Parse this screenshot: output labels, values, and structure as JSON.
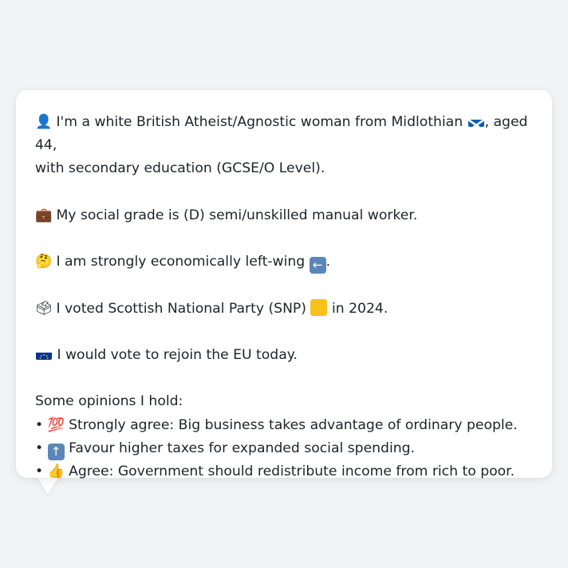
{
  "persona": {
    "line1_icon": "bust-in-silhouette-icon",
    "line1_text_a": "I'm a white British Atheist/Agnostic woman from Midlothian",
    "line1_flag": "scotland-flag-icon",
    "line1_text_b": ", aged 44,",
    "line1_text_c": "with secondary education (GCSE/O Level).",
    "line2_icon": "briefcase-icon",
    "line2_text": "My social grade is (D) semi/unskilled manual worker.",
    "line3_icon": "thinking-face-icon",
    "line3_text": "I am strongly economically left-wing",
    "line3_badge": "left-arrow-icon",
    "line3_end": ".",
    "line4_icon": "ballot-box-icon",
    "line4_text_a": "I voted Scottish National Party (SNP)",
    "line4_badge": "yellow-square-icon",
    "line4_text_b": "in 2024.",
    "line5_icon": "eu-flag-icon",
    "line5_text": "I would vote to rejoin the EU today."
  },
  "opinions": {
    "heading": "Some opinions I hold:",
    "items": [
      {
        "bullet": "•",
        "icon": "hundred-points-icon",
        "text": "Strongly agree: Big business takes advantage of ordinary people."
      },
      {
        "bullet": "•",
        "icon": "up-arrow-icon",
        "text": "Favour higher taxes for expanded social spending."
      },
      {
        "bullet": "•",
        "icon": "thumbs-up-icon",
        "text": "Agree: Government should redistribute income from rich to poor."
      }
    ]
  },
  "colors": {
    "background": "#f2f3f5",
    "bubble": "#ffffff",
    "text": "#1f2328",
    "snp_yellow": "#f7c21c",
    "arrow_badge": "#5b86b8",
    "scotland_blue": "#005eb8",
    "eu_blue": "#003399",
    "eu_star": "#ffcc00"
  }
}
